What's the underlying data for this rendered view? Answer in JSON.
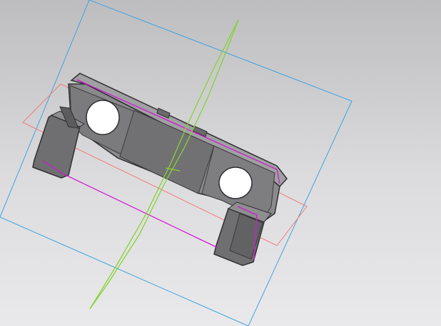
{
  "viewport": {
    "background_top": "#bdbdbf",
    "background_bottom": "#e9e9eb"
  },
  "colors": {
    "plane_blue": "#3fa3df",
    "plane_red": "#f07c78",
    "sketch_magenta": "#d21ad2",
    "axis_green": "#86d232",
    "part_light": "#8e8e90",
    "part_mid": "#6f6f71",
    "part_dark": "#4f4f51",
    "edge_dark": "#303032",
    "hole_fill": "#ffffff"
  },
  "icons": {
    "plane": "construction-plane",
    "part": "bracket-3d-part",
    "axis": "axis-line"
  }
}
